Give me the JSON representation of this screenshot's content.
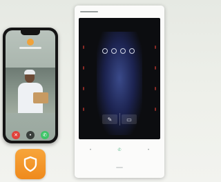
{
  "colors": {
    "app_icon": "#ef8a1d",
    "decline": "#e0413b",
    "accept": "#3ec467",
    "screen_glow": "#3a4a8a"
  },
  "icons": {
    "app": "shield-icon",
    "decline": "hang-up-icon",
    "mute": "mute-icon",
    "accept": "answer-call-icon",
    "door": "door-unlock-icon",
    "key": "key-icon",
    "call": "phone-icon"
  }
}
